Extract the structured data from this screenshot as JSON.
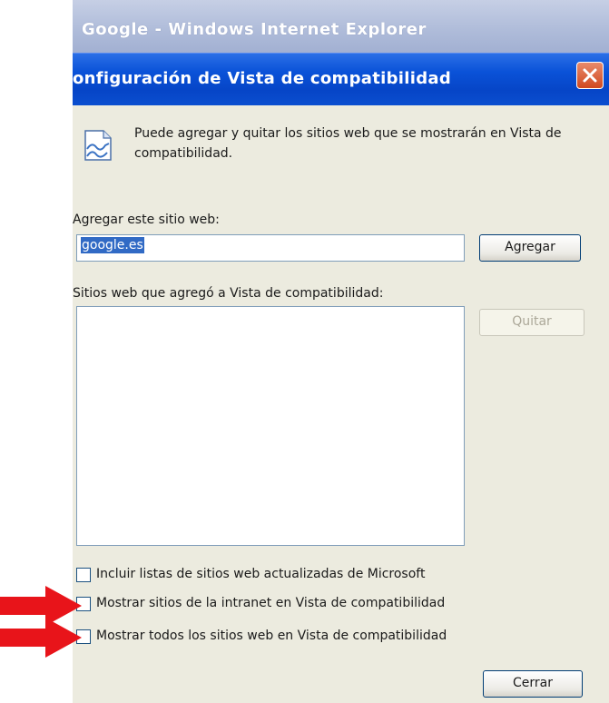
{
  "outer_window": {
    "title": "Google - Windows Internet Explorer"
  },
  "dialog": {
    "title": "onfiguración de Vista de compatibilidad",
    "info_text": "Puede agregar y quitar los sitios web que se mostrarán en Vista de compatibilidad.",
    "add_site_label": "Agregar este sitio web:",
    "add_site_value": "google.es",
    "add_button": "Agregar",
    "sites_list_label": "Sitios web que agregó a Vista de compatibilidad:",
    "sites_list_items": [],
    "remove_button": "Quitar",
    "checkboxes": [
      {
        "label": "Incluir listas de sitios web actualizadas de Microsoft",
        "checked": false
      },
      {
        "label": "Mostrar sitios de la intranet en Vista de compatibilidad",
        "checked": false
      },
      {
        "label": "Mostrar todos los sitios web en Vista de compatibilidad",
        "checked": false
      }
    ],
    "close_button": "Cerrar"
  },
  "colors": {
    "title_bar": "#0a52d8",
    "close_button": "#d0491f",
    "dialog_background": "#ecebdf",
    "annotation_arrow": "#e8141a"
  }
}
